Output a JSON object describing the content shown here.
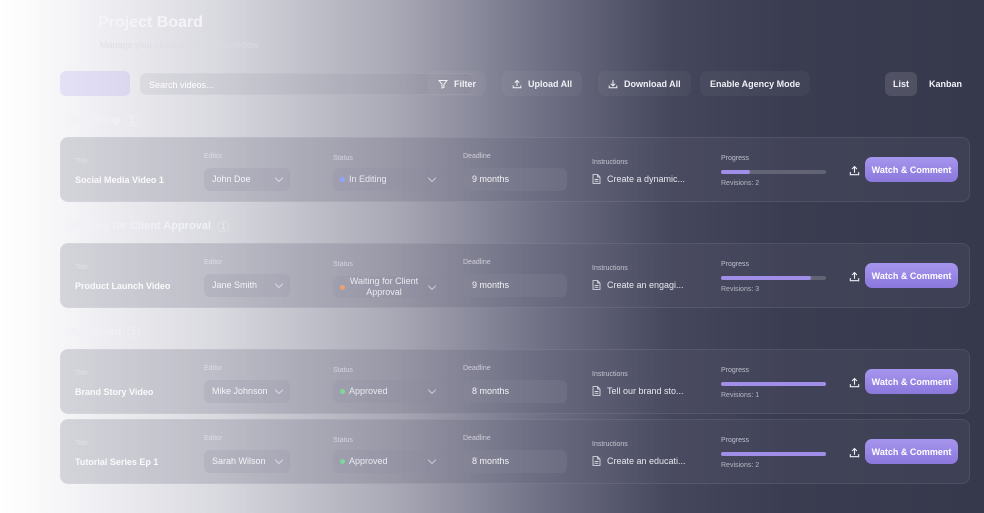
{
  "header": {
    "title": "Project Board",
    "subtitle": "Manage your video production workflow"
  },
  "toolbar": {
    "search_placeholder": "Search videos...",
    "filter_label": "Filter",
    "upload_all_label": "Upload All",
    "download_all_label": "Download All",
    "agency_mode_label": "Enable Agency Mode",
    "view_list_label": "List",
    "view_kanban_label": "Kanban"
  },
  "columns": {
    "title": "Title",
    "editor": "Editor",
    "status": "Status",
    "deadline": "Deadline",
    "instructions": "Instructions",
    "progress": "Progress"
  },
  "groups": [
    {
      "label": "In Editing",
      "count": "1"
    },
    {
      "label": "Waiting for Client Approval",
      "count": "1"
    },
    {
      "label": "Approved",
      "count": "2"
    }
  ],
  "cards": [
    {
      "title": "Social Media Video 1",
      "editor": "John Doe",
      "status": "In Editing",
      "deadline": "9 months",
      "instructions": "Create a dynamic...",
      "progress": 0.28,
      "revisions": "Revisions: 2",
      "action": "Watch & Comment"
    },
    {
      "title": "Product Launch Video",
      "editor": "Jane Smith",
      "status": "Waiting for Client Approval",
      "deadline": "9 months",
      "instructions": "Create an engagi...",
      "progress": 0.86,
      "revisions": "Revisions: 3",
      "action": "Watch & Comment"
    },
    {
      "title": "Brand Story Video",
      "editor": "Mike Johnson",
      "status": "Approved",
      "deadline": "8 months",
      "instructions": "Tell our brand sto...",
      "progress": 1.0,
      "revisions": "Revisions: 1",
      "action": "Watch & Comment"
    },
    {
      "title": "Tutorial Series Ep 1",
      "editor": "Sarah Wilson",
      "status": "Approved",
      "deadline": "8 months",
      "instructions": "Create an educati...",
      "progress": 1.0,
      "revisions": "Revisions: 2",
      "action": "Watch & Comment"
    }
  ],
  "colors": {
    "accent": "#a08ee8",
    "status_in_editing": "#8fa2ff",
    "status_waiting": "#f0a070",
    "status_approved": "#7fd89a"
  }
}
